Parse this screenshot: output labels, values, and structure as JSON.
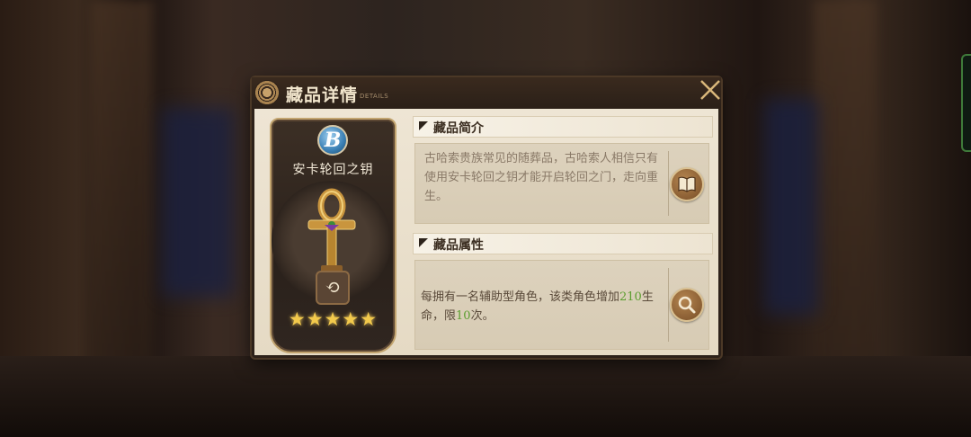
{
  "dialog": {
    "title": "藏品详情",
    "title_sub": "DETAILS",
    "close_icon": "close-icon"
  },
  "card": {
    "grade": "B",
    "name": "安卡轮回之钥",
    "cycle_symbol": "⟲",
    "stars": "★★★★★",
    "star_count": 5,
    "star_color": "#f2c94c"
  },
  "intro": {
    "heading": "藏品简介",
    "text": "古哈索贵族常见的随葬品，古哈索人相信只有使用安卡轮回之钥才能开启轮回之门，走向重生。",
    "button_icon": "book-icon"
  },
  "attributes": {
    "heading": "藏品属性",
    "text_before": "每拥有一名辅助型角色，该类角色增加",
    "value_hp": "210",
    "text_middle": "生命，限",
    "value_limit": "10",
    "text_after": "次。",
    "highlight_color": "#5b9d2f",
    "button_icon": "magnifier-icon"
  }
}
